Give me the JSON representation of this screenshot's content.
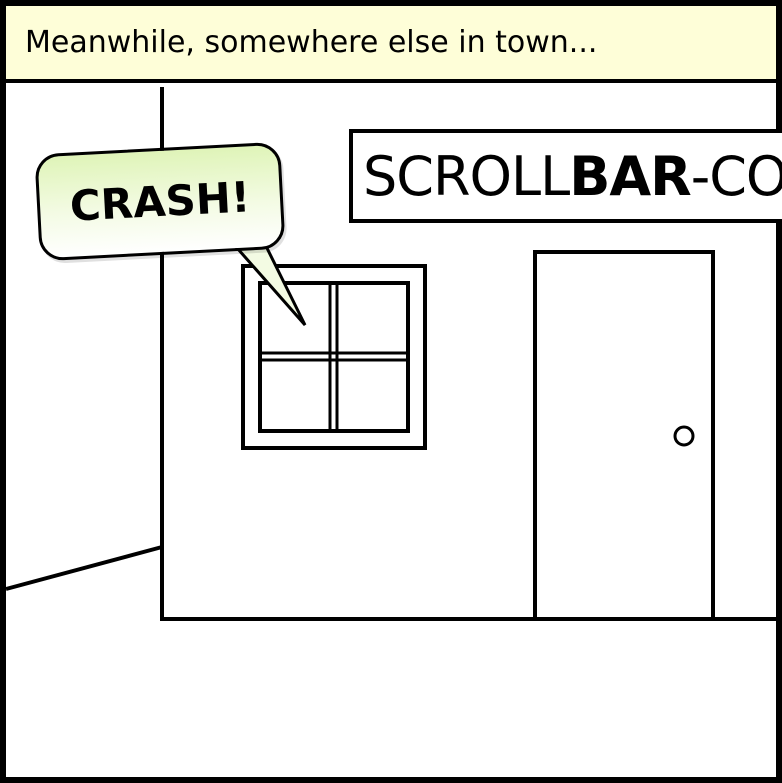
{
  "caption": {
    "text": "Meanwhile, somewhere else in town..."
  },
  "sign": {
    "text_regular": "SCROLL",
    "text_bold": "BAR",
    "text_tail": "-CO"
  },
  "speech_bubble": {
    "text": "CRASH!"
  },
  "colors": {
    "caption_background": "#fefed8",
    "bubble_gradient_top": "#dff4b8",
    "bubble_gradient_bottom": "#ffffff",
    "ink": "#000000"
  }
}
